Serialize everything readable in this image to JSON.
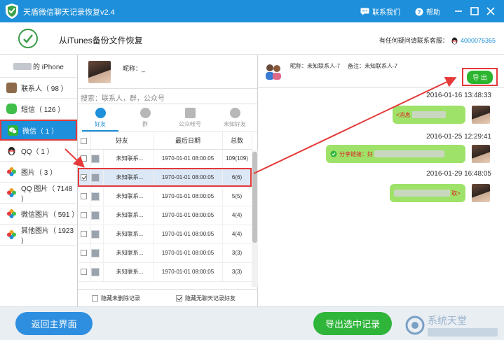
{
  "titlebar": {
    "title": "天盾微信聊天记录恢复v2.4",
    "contact_label": "联系我们",
    "help_label": "帮助",
    "minimize": "—",
    "close": "✕"
  },
  "subheader": {
    "heading": "从iTunes备份文件恢复",
    "support_text": "有任何疑问请联系客服：",
    "support_qq": "4000076365"
  },
  "sidebar": {
    "device_label": "的 iPhone",
    "items": [
      {
        "label": "联系人（ 98 ）",
        "icon_color": "#8d6b4a"
      },
      {
        "label": "短信（ 126 ）",
        "icon_color": "#3fbf4a"
      },
      {
        "label": "微信（ 1 ）",
        "icon_color": "#2fb53a"
      },
      {
        "label": "QQ（ 1 ）",
        "icon_color": "#222222"
      },
      {
        "label": "图片（ 3 ）",
        "icon_color": "#f0a020"
      },
      {
        "label": "QQ 图片（ 7148 ）",
        "icon_color": "#f0a020"
      },
      {
        "label": "微信图片（ 591 ）",
        "icon_color": "#e05a3a"
      },
      {
        "label": "其他图片（ 1923 ）",
        "icon_color": "#f0a020"
      }
    ],
    "active_index": 2
  },
  "middle": {
    "nickname_label": "昵称：_",
    "search_placeholder": "搜索：联系人，群，公众号",
    "tabs": [
      "好友",
      "群",
      "公众帐号",
      "未知好友"
    ],
    "columns": [
      "好友",
      "最后日期",
      "总数"
    ],
    "rows": [
      {
        "name": "未知联系...",
        "date": "1970-01-01 08:00:05",
        "count": "109(109)",
        "checked": false
      },
      {
        "name": "未知联系...",
        "date": "1970-01-01 08:00:05",
        "count": "6(6)",
        "checked": true
      },
      {
        "name": "未知联系...",
        "date": "1970-01-01 08:00:05",
        "count": "5(5)",
        "checked": false
      },
      {
        "name": "未知联系...",
        "date": "1970-01-01 08:00:05",
        "count": "4(4)",
        "checked": false
      },
      {
        "name": "未知联系...",
        "date": "1970-01-01 08:00:05",
        "count": "4(4)",
        "checked": false
      },
      {
        "name": "未知联系...",
        "date": "1970-01-01 08:00:05",
        "count": "3(3)",
        "checked": false
      },
      {
        "name": "未知联系...",
        "date": "1970-01-01 08:00:05",
        "count": "3(3)",
        "checked": false
      },
      {
        "name": "未知联系...",
        "date": "1970-01-01 08:00:05",
        "count": "3(3)",
        "checked": false
      }
    ],
    "hide_deleted_label": "隐藏未删除记录",
    "hide_empty_label": "隐藏无聊天记录好友"
  },
  "chat": {
    "nickname": "昵称：未知联系人-7",
    "note": "备注：未知联系人-7",
    "export_label": "导 出",
    "messages": [
      {
        "time": "2016-01-16 13:48:33",
        "text": "<消息"
      },
      {
        "time": "2016-01-25 12:29:41",
        "text": "分享链接：好"
      },
      {
        "time": "2016-01-29 16:48:05",
        "text": "取>"
      }
    ]
  },
  "bottom": {
    "back_label": "返回主界面",
    "export_selected_label": "导出选中记录",
    "watermark": "系统天堂"
  },
  "colors": {
    "primary": "#1e8fda",
    "green": "#2fb53a",
    "highlight": "#e43a3a",
    "bubble": "#9fe269"
  }
}
